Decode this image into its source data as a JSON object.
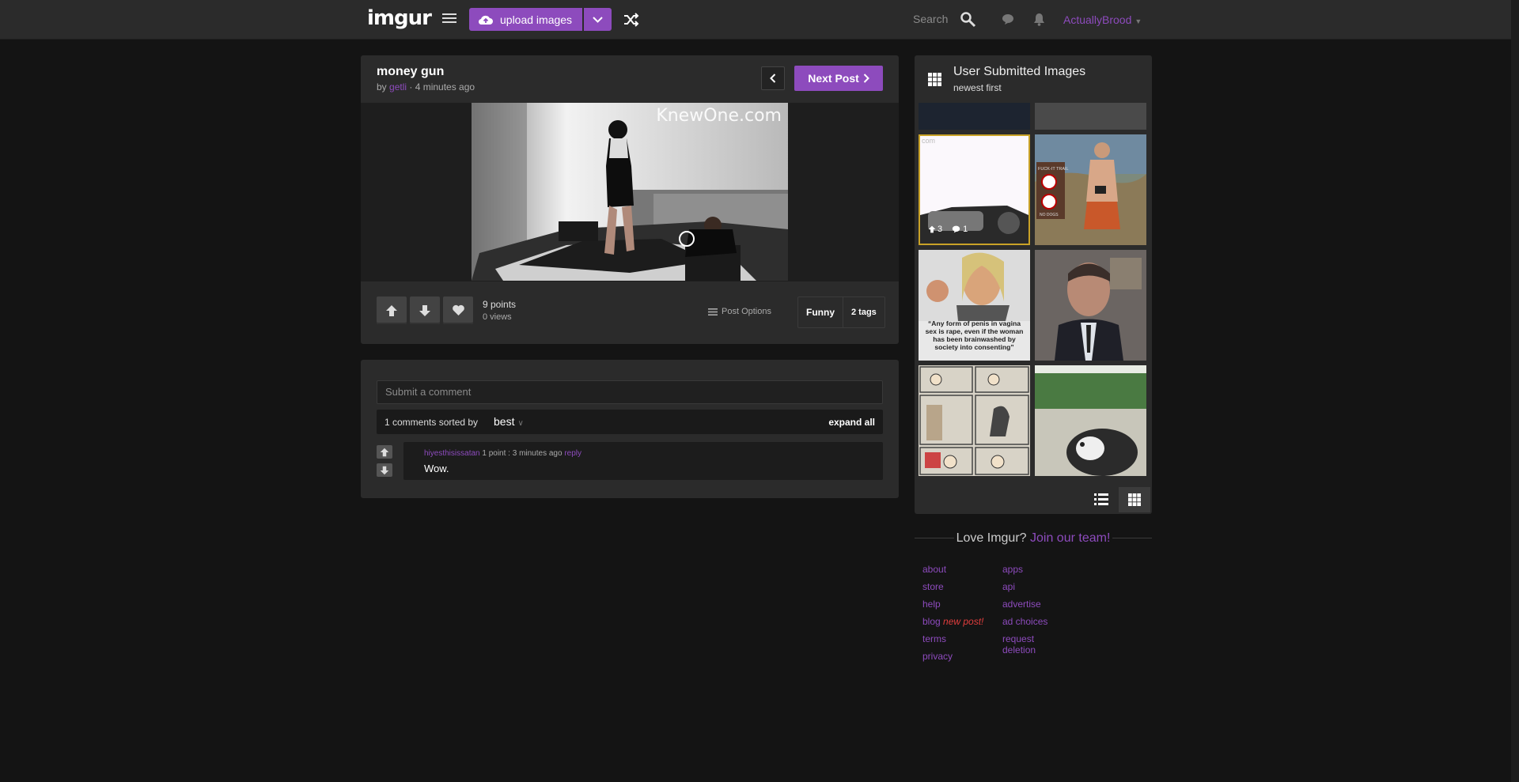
{
  "header": {
    "logo": "imgur",
    "upload_label": "upload images",
    "search_placeholder": "Search",
    "username": "ActuallyBrood"
  },
  "post": {
    "title": "money gun",
    "by": "by ",
    "author": "getli",
    "time": " · 4 minutes ago",
    "next_label": "Next Post",
    "watermark": "KnewOne.com",
    "points": "9 points",
    "views": "0 views",
    "post_options": "Post Options",
    "tag_main": "Funny",
    "tag_count": "2 tags"
  },
  "comments": {
    "input_placeholder": "Submit a comment",
    "sort_text": "1 comments sorted by",
    "sort_value": "best",
    "expand_all": "expand all",
    "items": [
      {
        "user": "hiyesthisissatan",
        "meta": " 1 point : 3 minutes ago ",
        "reply": "reply",
        "text": "Wow."
      }
    ]
  },
  "gallery": {
    "title": "User Submitted Images",
    "subtitle": "newest first",
    "thumb_partial_label": "com",
    "selected_upvotes": "3",
    "selected_comments": "1",
    "meme_caption": "“Any form of penis in vagina sex is rape, even if the woman has been brainwashed by society into consenting”",
    "sign_text": "FUCK-IT TRAIL",
    "sign_text2": "NO DOGS"
  },
  "footer": {
    "love_text": "Love Imgur? ",
    "join_text": "Join our team!",
    "col1": [
      "about",
      "store",
      "help",
      "blog",
      "terms",
      "privacy"
    ],
    "blog_new": "new post!",
    "col2": [
      "apps",
      "api",
      "advertise",
      "ad choices",
      "request",
      "deletion"
    ]
  },
  "colors": {
    "accent": "#8d4bbd",
    "background": "#141414",
    "panel": "#2b2b2b",
    "selected_border": "#c9a227"
  }
}
